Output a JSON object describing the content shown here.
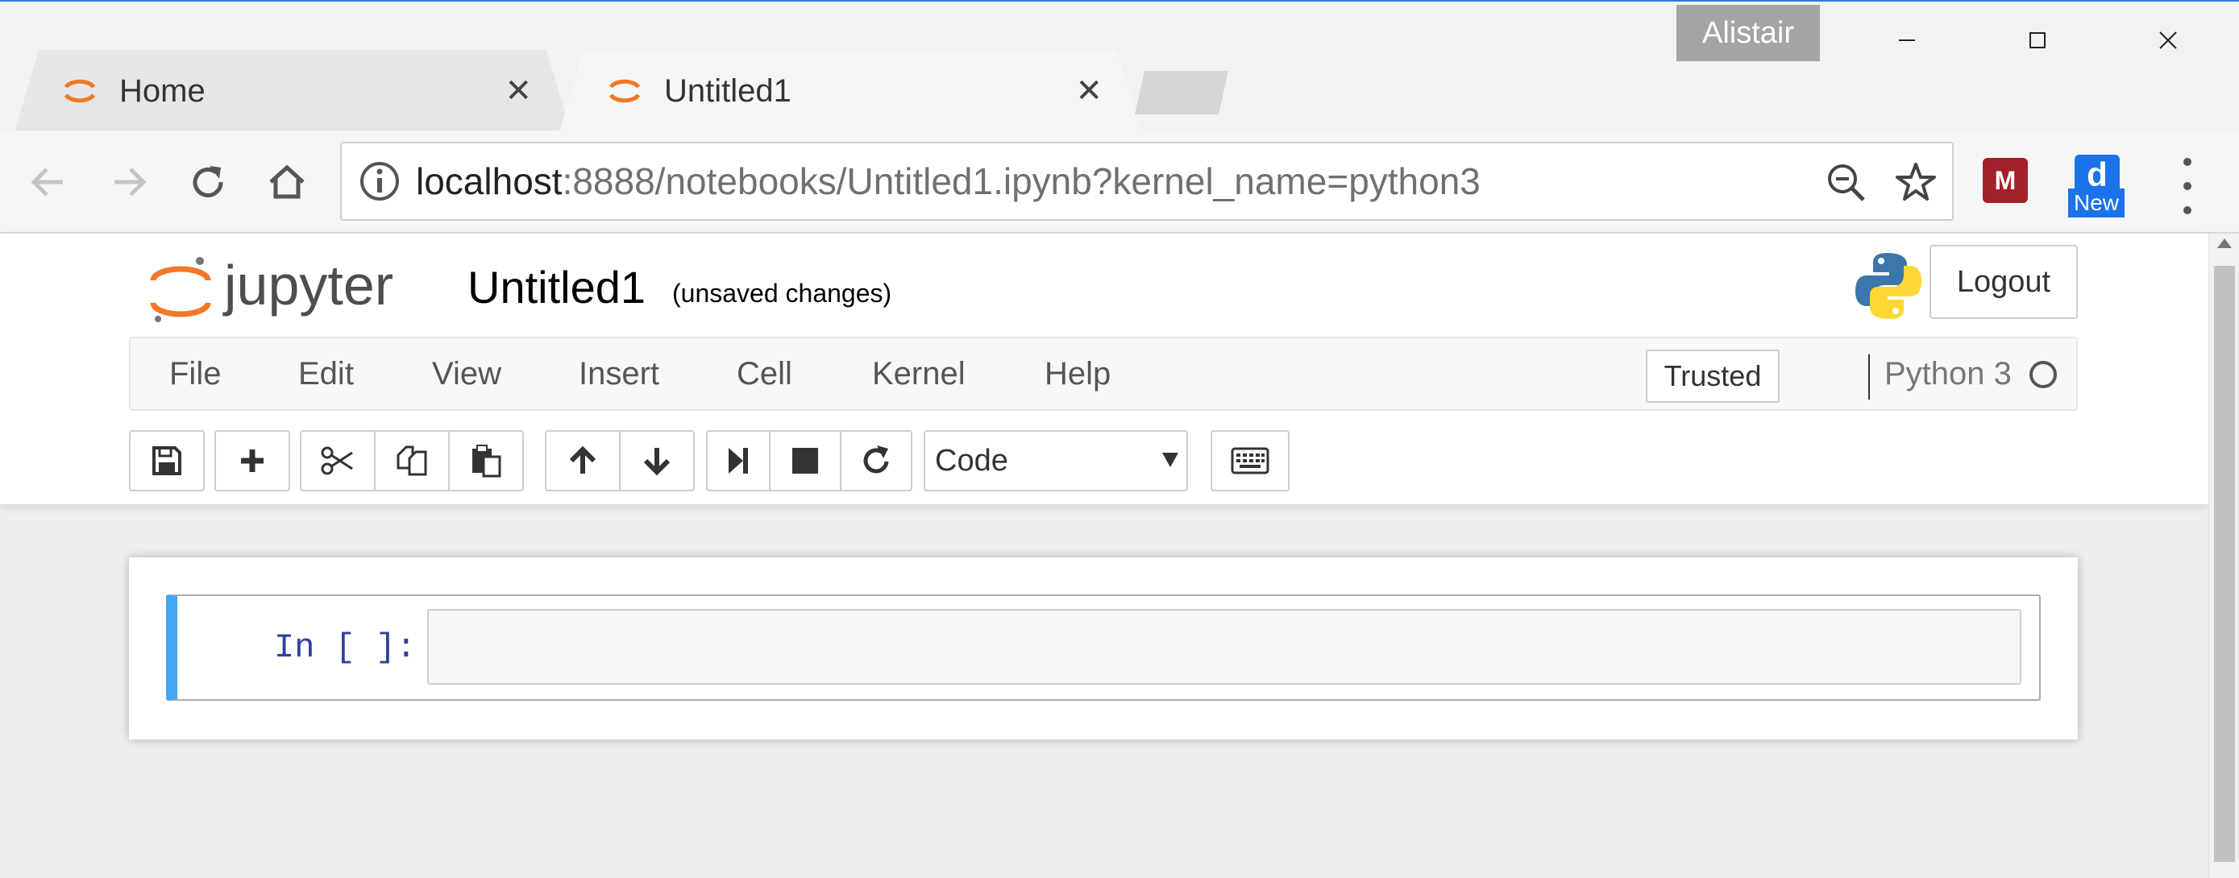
{
  "browser": {
    "tabs": [
      {
        "title": "Home",
        "close": "✕"
      },
      {
        "title": "Untitled1",
        "close": "✕"
      }
    ],
    "profile_name": "Alistair",
    "url_host": "localhost",
    "url_rest": ":8888/notebooks/Untitled1.ipynb?kernel_name=python3",
    "extension_badge": "New",
    "extension_letter": "d",
    "extension_mendeley": "M"
  },
  "header": {
    "logo_text": "jupyter",
    "notebook_title": "Untitled1",
    "save_status": "(unsaved changes)",
    "logout_label": "Logout"
  },
  "menubar": {
    "items": [
      "File",
      "Edit",
      "View",
      "Insert",
      "Cell",
      "Kernel",
      "Help"
    ],
    "trusted_label": "Trusted",
    "kernel_name": "Python 3"
  },
  "toolbar": {
    "cell_type": "Code"
  },
  "notebook": {
    "cells": [
      {
        "prompt": "In [ ]:",
        "source": ""
      }
    ]
  },
  "colors": {
    "jupyter_orange": "#f37726",
    "cell_selected_bar": "#42a5f5",
    "prompt_blue": "#303f9f"
  }
}
